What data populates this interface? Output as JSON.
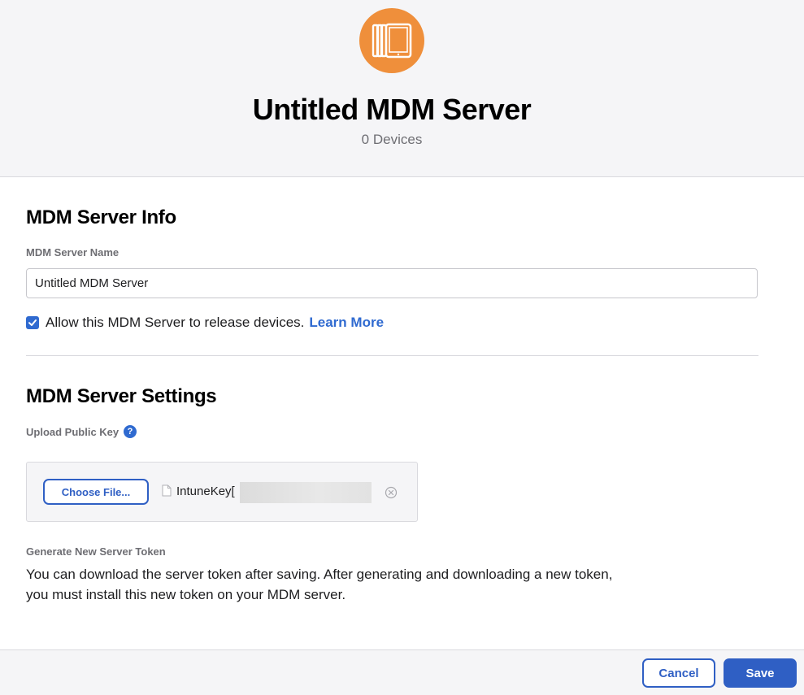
{
  "header": {
    "icon": "ipad-stack-icon",
    "icon_color": "#ef8f3b",
    "title": "Untitled MDM Server",
    "device_count": "0 Devices"
  },
  "info_section": {
    "title": "MDM Server Info",
    "name_label": "MDM Server Name",
    "name_value": "Untitled MDM Server",
    "allow_release_checked": true,
    "allow_release_label": "Allow this MDM Server to release devices.",
    "learn_more": "Learn More"
  },
  "settings_section": {
    "title": "MDM Server Settings",
    "upload_label": "Upload Public Key",
    "help_glyph": "?",
    "choose_file_label": "Choose File...",
    "file_name": "IntuneKey[",
    "token_label": "Generate New Server Token",
    "token_description": "You can download the server token after saving. After generating and downloading a new token, you must install this new token on your MDM server."
  },
  "footer": {
    "cancel_label": "Cancel",
    "save_label": "Save"
  },
  "colors": {
    "accent": "#2f5fc4",
    "link": "#2f6ad0",
    "header_bg": "#f5f5f7"
  }
}
